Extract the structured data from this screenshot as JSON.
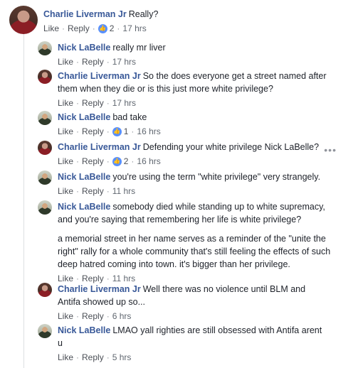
{
  "thread": {
    "root": {
      "author": "Charlie Liverman Jr",
      "text": "Really?",
      "like": "Like",
      "reply": "Reply",
      "reactions": "2",
      "time": "17 hrs"
    },
    "replies": [
      {
        "author": "Nick LaBelle",
        "text": "really mr liver",
        "like": "Like",
        "reply": "Reply",
        "reactions": "",
        "time": "17 hrs"
      },
      {
        "author": "Charlie Liverman Jr",
        "text": "So the does everyone get a street named after them when they die or is this just more white privilege?",
        "like": "Like",
        "reply": "Reply",
        "reactions": "",
        "time": "17 hrs"
      },
      {
        "author": "Nick LaBelle",
        "text": "bad take",
        "like": "Like",
        "reply": "Reply",
        "reactions": "1",
        "time": "16 hrs"
      },
      {
        "author": "Charlie Liverman Jr",
        "text": "Defending your white privilege Nick LaBelle?",
        "like": "Like",
        "reply": "Reply",
        "reactions": "2",
        "time": "16 hrs"
      },
      {
        "author": "Nick LaBelle",
        "text": "you're using the term \"white privilege\" very strangely.",
        "like": "Like",
        "reply": "Reply",
        "reactions": "",
        "time": "11 hrs"
      },
      {
        "author": "Nick LaBelle",
        "text": "somebody died while standing up to white supremacy, and you're saying that remembering her life is white privilege?",
        "text2": "a memorial street in her name serves as a reminder of the \"unite the right\" rally for a whole community that's still feeling the effects of such deep hatred coming into town. it's bigger than her privilege.",
        "like": "Like",
        "reply": "Reply",
        "reactions": "",
        "time": "11 hrs"
      },
      {
        "author": "Charlie Liverman Jr",
        "text": "Well there was no violence until BLM and Antifa showed up so...",
        "like": "Like",
        "reply": "Reply",
        "reactions": "",
        "time": "6 hrs"
      },
      {
        "author": "Nick LaBelle",
        "text": "LMAO yall righties are still obsessed with Antifa arent u",
        "like": "Like",
        "reply": "Reply",
        "reactions": "",
        "time": "5 hrs"
      }
    ],
    "more_options": "•••",
    "colors": {
      "author": "#385898",
      "like_badge": "#5890ff",
      "meta": "#606770"
    },
    "icons": {
      "like_badge": "thumbs-up-icon",
      "more": "more-options-icon"
    }
  }
}
